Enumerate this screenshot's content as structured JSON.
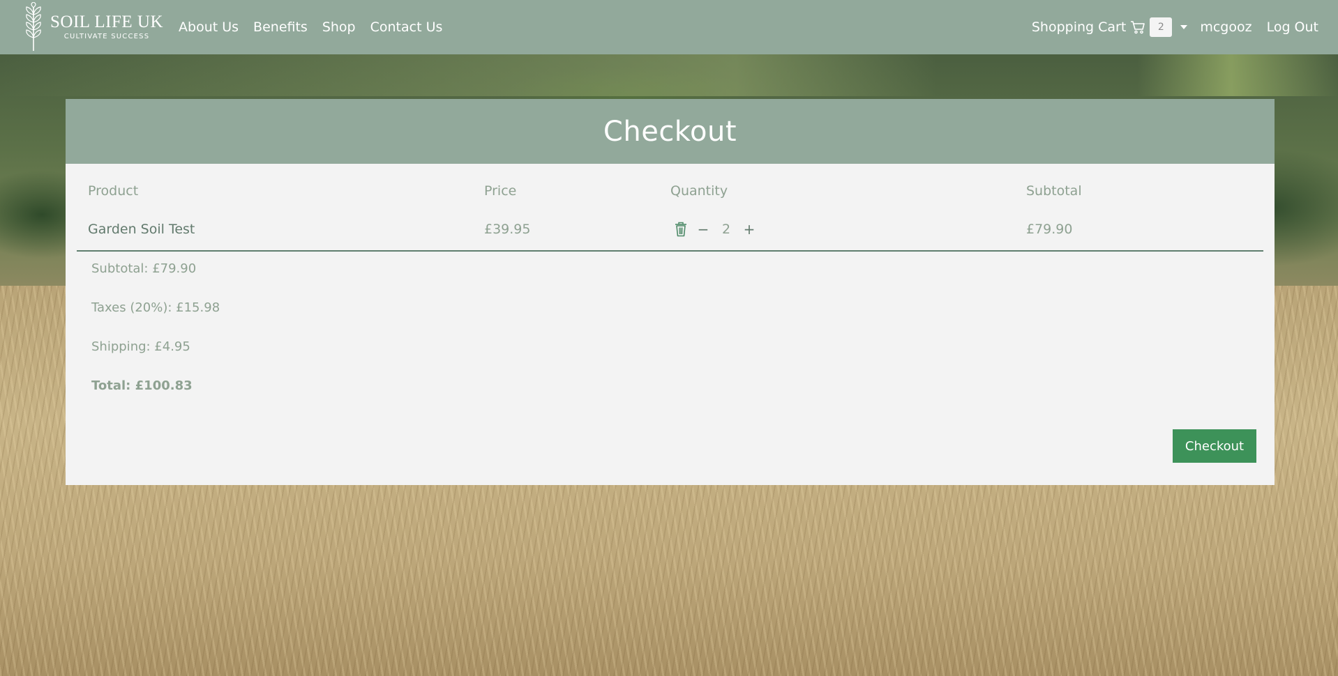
{
  "brand": {
    "name": "SOIL LIFE UK",
    "tagline": "CULTIVATE SUCCESS"
  },
  "nav": {
    "links": [
      "About Us",
      "Benefits",
      "Shop",
      "Contact Us"
    ],
    "cart_label": "Shopping Cart",
    "cart_count": "2",
    "username": "mcgooz",
    "logout": "Log Out"
  },
  "checkout": {
    "title": "Checkout",
    "columns": {
      "product": "Product",
      "price": "Price",
      "quantity": "Quantity",
      "subtotal": "Subtotal"
    },
    "items": [
      {
        "product": "Garden Soil Test",
        "price": "£39.95",
        "quantity": "2",
        "subtotal": "£79.90"
      }
    ],
    "summary": {
      "subtotal": "Subtotal: £79.90",
      "taxes": "Taxes (20%): £15.98",
      "shipping": "Shipping: £4.95",
      "total": "Total: £100.83"
    },
    "button_label": "Checkout"
  },
  "colors": {
    "navbar": "#92a99b",
    "card_header": "#92a99b",
    "card_body": "#f3f3f3",
    "button": "#3d9259",
    "muted_text": "#8ea191"
  },
  "icons": {
    "logo": "wheat-icon",
    "cart": "cart-icon",
    "dropdown": "caret-down-icon",
    "remove": "trash-icon"
  }
}
